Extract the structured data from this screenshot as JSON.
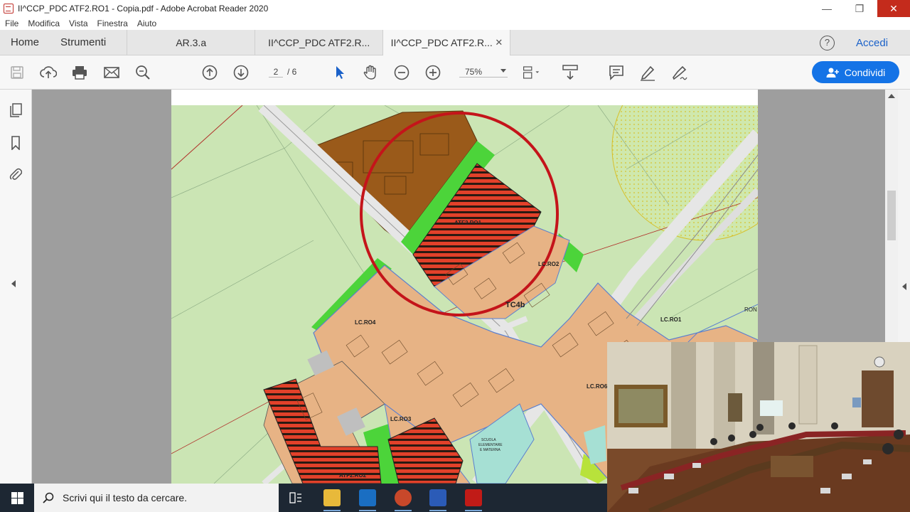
{
  "window": {
    "title": "II^CCP_PDC ATF2.RO1 - Copia.pdf - Adobe Acrobat Reader 2020"
  },
  "menu": [
    "File",
    "Modifica",
    "Vista",
    "Finestra",
    "Aiuto"
  ],
  "tabs": {
    "home": "Home",
    "tools": "Strumenti",
    "documents": [
      {
        "label": "AR.3.a"
      },
      {
        "label": "II^CCP_PDC ATF2.R..."
      },
      {
        "label": "II^CCP_PDC ATF2.R...",
        "active": true
      }
    ],
    "help_icon": "help-icon",
    "signin": "Accedi"
  },
  "toolbar": {
    "page_current": "2",
    "page_total": "/ 6",
    "zoom": "75%",
    "share_label": "Condividi",
    "icons": [
      "save-icon",
      "upload-icon",
      "print-icon",
      "email-icon",
      "search-icon",
      "prev-page-icon",
      "next-page-icon",
      "select-icon",
      "hand-icon",
      "zoom-out-icon",
      "zoom-in-icon",
      "fit-icon",
      "scroll-icon",
      "comment-icon",
      "highlight-icon",
      "sign-icon"
    ]
  },
  "left_panel": [
    "pages-icon",
    "bookmark-icon",
    "attachment-icon"
  ],
  "map": {
    "labels": {
      "atf": "ATF2.RO1",
      "lc_ro2": "LC.RO2",
      "lc_ro4": "LC.RO4",
      "lc_ro3": "LC.RO3",
      "lc_ro6": "LC.RO6",
      "lc_ro1": "LC.RO1",
      "tc4b": "TC4b",
      "atf_ro2": "ATF2.RO2",
      "scuola": "SCUOLA",
      "elementare": "ELEMENTARE",
      "materna": "E MATERNA",
      "ron": "RON"
    }
  },
  "taskbar": {
    "search_placeholder": "Scrivi qui il testo da cercare."
  },
  "colors": {
    "accent": "#1473e6",
    "close": "#c42b1c",
    "highlight_circle": "#c4141a"
  }
}
